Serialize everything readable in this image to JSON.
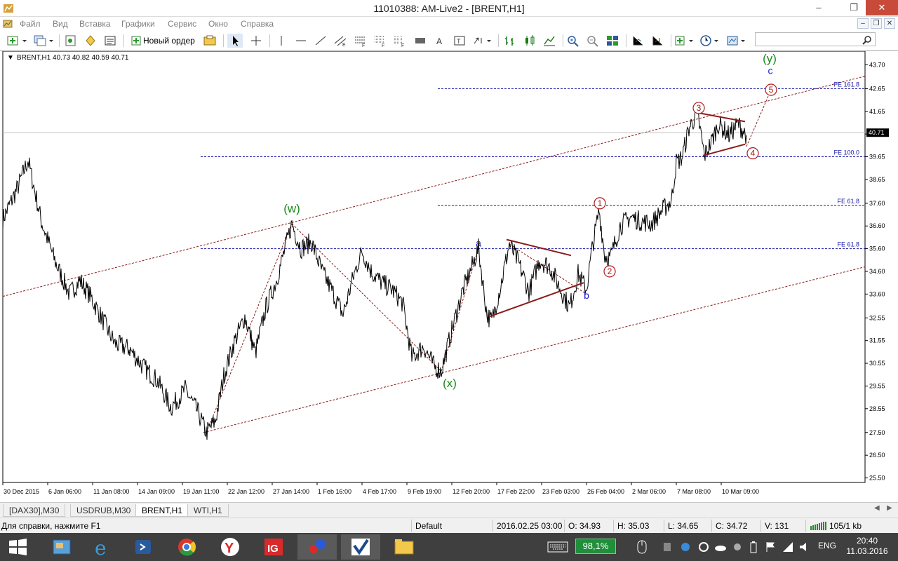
{
  "window": {
    "title": "11010388: AM-Live2 - [BRENT,H1]",
    "minimize": "–",
    "restore": "❐",
    "close": "✕"
  },
  "menu": {
    "items": [
      "Файл",
      "Вид",
      "Вставка",
      "Графики",
      "Сервис",
      "Окно",
      "Справка"
    ],
    "mdi_min": "–",
    "mdi_restore": "❐",
    "mdi_close": "✕"
  },
  "toolbar": {
    "new_order_label": "Новый ордер",
    "search_value": "",
    "icons": [
      "new-chart-icon",
      "profiles-icon",
      "market-watch-icon",
      "navigator-icon",
      "terminal-icon",
      "new-order-icon",
      "metaeditor-icon",
      "cursor-icon",
      "crosshair-icon",
      "vertical-line-icon",
      "horizontal-line-icon",
      "trendline-icon",
      "fibonacci-icon",
      "channel-icon",
      "gann-icon",
      "rectangle-icon",
      "text-icon",
      "text-label-icon",
      "arrows-icon",
      "bar-chart-icon",
      "candles-icon",
      "line-chart-icon",
      "zoom-in-icon",
      "zoom-out-icon",
      "tile-windows-icon",
      "autoscroll-icon",
      "chart-shift-icon",
      "indicators-icon",
      "periods-icon",
      "templates-icon",
      "search-icon"
    ]
  },
  "chart_data": {
    "type": "line",
    "header": "BRENT,H1  40.73 40.82 40.59 40.71",
    "symbol": "BRENT",
    "timeframe": "H1",
    "ohlc": {
      "open": 40.73,
      "high": 40.82,
      "low": 40.59,
      "close": 40.71
    },
    "current_price_label": "40.71",
    "y_ticks": [
      "43.70",
      "42.65",
      "41.65",
      "40.71",
      "39.65",
      "38.65",
      "37.60",
      "36.60",
      "35.60",
      "34.60",
      "33.60",
      "32.55",
      "31.55",
      "30.55",
      "29.55",
      "28.55",
      "27.50",
      "26.50",
      "25.50"
    ],
    "y_tick_values": [
      43.7,
      42.65,
      41.65,
      40.65,
      39.65,
      38.65,
      37.6,
      36.6,
      35.6,
      34.6,
      33.6,
      32.55,
      31.55,
      30.55,
      29.55,
      28.55,
      27.5,
      26.5,
      25.5
    ],
    "ylim": [
      25.3,
      44.3
    ],
    "x_tick_labels": [
      "30 Dec 2015",
      "6 Jan 06:00",
      "11 Jan 08:00",
      "14 Jan 09:00",
      "19 Jan 11:00",
      "22 Jan 12:00",
      "27 Jan 14:00",
      "1 Feb 16:00",
      "4 Feb 17:00",
      "9 Feb 19:00",
      "12 Feb 20:00",
      "17 Feb 22:00",
      "23 Feb 03:00",
      "26 Feb 04:00",
      "2 Mar 06:00",
      "7 Mar 08:00",
      "10 Mar 09:00"
    ],
    "price_anchors": [
      [
        0,
        36.9
      ],
      [
        20,
        38.2
      ],
      [
        36,
        39.5
      ],
      [
        55,
        36.8
      ],
      [
        75,
        35.0
      ],
      [
        95,
        33.6
      ],
      [
        110,
        34.2
      ],
      [
        125,
        33.5
      ],
      [
        140,
        32.6
      ],
      [
        160,
        31.4
      ],
      [
        180,
        31.2
      ],
      [
        200,
        30.4
      ],
      [
        220,
        29.8
      ],
      [
        240,
        28.6
      ],
      [
        260,
        29.4
      ],
      [
        278,
        28.4
      ],
      [
        290,
        27.5
      ],
      [
        303,
        28.0
      ],
      [
        315,
        30.0
      ],
      [
        330,
        31.5
      ],
      [
        345,
        32.6
      ],
      [
        360,
        31.0
      ],
      [
        375,
        33.0
      ],
      [
        390,
        34.2
      ],
      [
        412,
        36.7
      ],
      [
        425,
        35.6
      ],
      [
        440,
        35.9
      ],
      [
        455,
        34.6
      ],
      [
        470,
        33.7
      ],
      [
        485,
        32.7
      ],
      [
        500,
        34.4
      ],
      [
        512,
        35.5
      ],
      [
        525,
        34.6
      ],
      [
        540,
        34.1
      ],
      [
        555,
        33.8
      ],
      [
        570,
        33.2
      ],
      [
        583,
        30.8
      ],
      [
        600,
        31.3
      ],
      [
        615,
        30.4
      ],
      [
        625,
        30.2
      ],
      [
        640,
        32.0
      ],
      [
        655,
        33.7
      ],
      [
        665,
        34.5
      ],
      [
        678,
        35.6
      ],
      [
        690,
        32.7
      ],
      [
        697,
        32.4
      ],
      [
        710,
        34.0
      ],
      [
        722,
        35.8
      ],
      [
        735,
        35.0
      ],
      [
        750,
        33.7
      ],
      [
        765,
        35.1
      ],
      [
        780,
        34.8
      ],
      [
        795,
        33.8
      ],
      [
        808,
        33.0
      ],
      [
        820,
        34.5
      ],
      [
        832,
        33.8
      ],
      [
        840,
        35.6
      ],
      [
        850,
        37.3
      ],
      [
        858,
        35.3
      ],
      [
        866,
        35.2
      ],
      [
        880,
        36.6
      ],
      [
        895,
        37.0
      ],
      [
        910,
        36.8
      ],
      [
        925,
        36.7
      ],
      [
        940,
        37.3
      ],
      [
        953,
        37.7
      ],
      [
        960,
        39.4
      ],
      [
        968,
        39.6
      ],
      [
        978,
        40.9
      ],
      [
        990,
        41.6
      ],
      [
        1000,
        39.7
      ],
      [
        1010,
        40.3
      ],
      [
        1020,
        41.1
      ],
      [
        1035,
        40.6
      ],
      [
        1048,
        41.1
      ],
      [
        1060,
        40.6
      ]
    ],
    "wave_labels": [
      {
        "text": "(w)",
        "color": "#1a8a1a",
        "price": 37.2,
        "bar": 412
      },
      {
        "text": "(x)",
        "color": "#1a8a1a",
        "price": 29.5,
        "bar": 637
      },
      {
        "text": "(y)",
        "color": "#1a8a1a",
        "price": 43.8,
        "bar": 1093
      },
      {
        "text": "a",
        "color": "#1a1acc",
        "price": 35.7,
        "bar": 678
      },
      {
        "text": "b",
        "color": "#1a1acc",
        "price": 33.4,
        "bar": 832
      },
      {
        "text": "c",
        "color": "#1a1acc",
        "price": 43.3,
        "bar": 1094
      },
      {
        "text": "1",
        "color": "#b01818",
        "price": 37.6,
        "bar": 851
      },
      {
        "text": "2",
        "color": "#b01818",
        "price": 34.6,
        "bar": 865
      },
      {
        "text": "3",
        "color": "#b01818",
        "price": 41.8,
        "bar": 992
      },
      {
        "text": "4",
        "color": "#b01818",
        "price": 39.8,
        "bar": 1069
      },
      {
        "text": "5",
        "color": "#b01818",
        "price": 42.6,
        "bar": 1095
      }
    ],
    "fib_levels": [
      {
        "label": "FE 161.8",
        "price": 42.65
      },
      {
        "label": "FE 100.0",
        "price": 39.65
      },
      {
        "label": "FE 61.8",
        "price": 37.5
      },
      {
        "label": "FE 61.8",
        "price": 35.6
      }
    ],
    "colors": {
      "price": "#000000",
      "fib": "#1a1aa8",
      "channel": "#8b1a1a",
      "triangle": "#8b1a1a",
      "label_green": "#1a8a1a",
      "label_blue": "#1a1acc",
      "label_red": "#b01818"
    }
  },
  "tabs": {
    "items": [
      "[DAX30],M30",
      "USDRUB,M30",
      "BRENT,H1",
      "WTI,H1"
    ],
    "active": "BRENT,H1"
  },
  "status": {
    "help": "Для справки, нажмите F1",
    "profile": "Default",
    "datetime": "2016.02.25 03:00",
    "open": "O: 34.93",
    "high": "H: 35.03",
    "low": "L: 34.65",
    "close": "C: 34.72",
    "volume": "V: 131",
    "traffic": "105/1 kb"
  },
  "taskbar": {
    "battery": "98,1%",
    "language": "ENG",
    "time": "20:40",
    "date": "11.03.2016",
    "apps": [
      "windows-start-icon",
      "explorer-folder-icon",
      "internet-explorer-icon",
      "remote-app-icon",
      "chrome-icon",
      "yandex-browser-icon",
      "ig-app-icon",
      "dots-app-icon",
      "checkmark-app-icon",
      "file-explorer-icon"
    ]
  }
}
